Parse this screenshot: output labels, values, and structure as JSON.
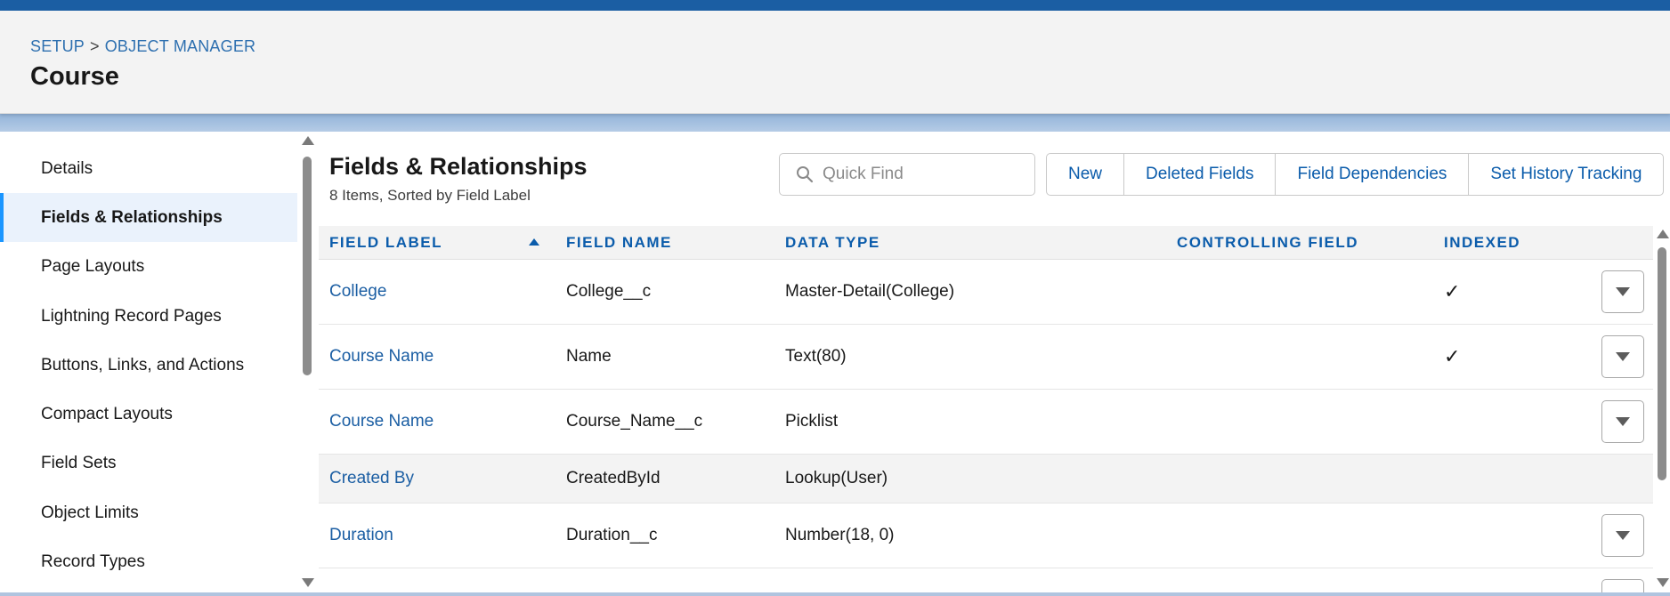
{
  "breadcrumb": {
    "setup": "SETUP",
    "separator": ">",
    "object_manager": "OBJECT MANAGER"
  },
  "page_title": "Course",
  "sidebar": {
    "items": [
      {
        "label": "Details"
      },
      {
        "label": "Fields & Relationships",
        "active": true
      },
      {
        "label": "Page Layouts"
      },
      {
        "label": "Lightning Record Pages"
      },
      {
        "label": "Buttons, Links, and Actions"
      },
      {
        "label": "Compact Layouts"
      },
      {
        "label": "Field Sets"
      },
      {
        "label": "Object Limits"
      },
      {
        "label": "Record Types"
      }
    ]
  },
  "main": {
    "title": "Fields & Relationships",
    "subtitle": "8 Items, Sorted by Field Label",
    "search": {
      "placeholder": "Quick Find",
      "value": "",
      "icon": "search-icon"
    },
    "buttons": {
      "new": "New",
      "deleted_fields": "Deleted Fields",
      "field_dependencies": "Field Dependencies",
      "set_history_tracking": "Set History Tracking"
    }
  },
  "table": {
    "columns": [
      "FIELD LABEL",
      "FIELD NAME",
      "DATA TYPE",
      "CONTROLLING FIELD",
      "INDEXED"
    ],
    "rows": [
      {
        "label": "College",
        "name": "College__c",
        "type": "Master-Detail(College)",
        "controlling": "",
        "indexed": "✓"
      },
      {
        "label": "Course Name",
        "name": "Name",
        "type": "Text(80)",
        "controlling": "",
        "indexed": "✓"
      },
      {
        "label": "Course Name",
        "name": "Course_Name__c",
        "type": "Picklist",
        "controlling": "",
        "indexed": ""
      },
      {
        "label": "Created By",
        "name": "CreatedById",
        "type": "Lookup(User)",
        "controlling": "",
        "indexed": ""
      },
      {
        "label": "Duration",
        "name": "Duration__c",
        "type": "Number(18, 0)",
        "controlling": "",
        "indexed": ""
      }
    ]
  },
  "colors": {
    "accent": "#1b96ff",
    "link": "#0b5cab",
    "brand_band": "#1b5ea3"
  }
}
